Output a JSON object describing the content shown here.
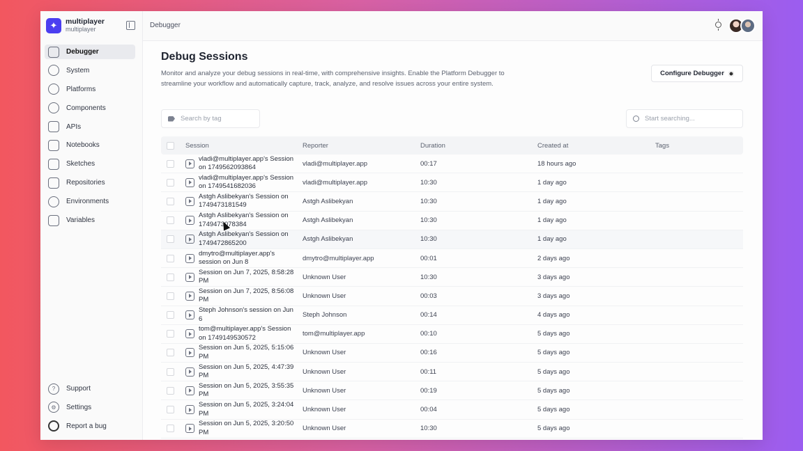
{
  "app": {
    "name": "multiplayer",
    "workspace": "multiplayer"
  },
  "sidebar": {
    "items": [
      {
        "label": "Debugger",
        "icon": "play-icon",
        "active": true
      },
      {
        "label": "System",
        "icon": "chart-icon"
      },
      {
        "label": "Platforms",
        "icon": "cube-icon"
      },
      {
        "label": "Components",
        "icon": "hexagon-icon"
      },
      {
        "label": "APIs",
        "icon": "api-icon"
      },
      {
        "label": "Notebooks",
        "icon": "notebook-icon"
      },
      {
        "label": "Sketches",
        "icon": "pencil-icon"
      },
      {
        "label": "Repositories",
        "icon": "code-icon"
      },
      {
        "label": "Environments",
        "icon": "cloud-icon"
      },
      {
        "label": "Variables",
        "icon": "variable-icon"
      }
    ],
    "bottom": [
      {
        "label": "Support",
        "icon": "help-icon"
      },
      {
        "label": "Settings",
        "icon": "gear-icon"
      },
      {
        "label": "Report a bug",
        "icon": "bug-icon"
      }
    ]
  },
  "topbar": {
    "breadcrumb": "Debugger"
  },
  "page": {
    "title": "Debug Sessions",
    "description": "Monitor and analyze your debug sessions in real-time, with comprehensive insights. Enable the Platform Debugger to streamline your workflow and automatically capture, track, analyze, and resolve issues across your entire system.",
    "configure_label": "Configure Debugger",
    "tag_placeholder": "Search by tag",
    "search_placeholder": "Start searching..."
  },
  "table": {
    "columns": [
      "Session",
      "Reporter",
      "Duration",
      "Created at",
      "Tags"
    ],
    "rows": [
      {
        "session": "vladi@multiplayer.app's Session on 1749562093864",
        "reporter": "vladi@multiplayer.app",
        "duration": "00:17",
        "created": "18 hours ago"
      },
      {
        "session": "vladi@multiplayer.app's Session on 1749541682036",
        "reporter": "vladi@multiplayer.app",
        "duration": "10:30",
        "created": "1 day ago"
      },
      {
        "session": "Astgh Aslibekyan's Session on 1749473181549",
        "reporter": "Astgh Aslibekyan",
        "duration": "10:30",
        "created": "1 day ago"
      },
      {
        "session": "Astgh Aslibekyan's Session on 1749473078384",
        "reporter": "Astgh Aslibekyan",
        "duration": "10:30",
        "created": "1 day ago"
      },
      {
        "session": "Astgh Aslibekyan's Session on 1749472865200",
        "reporter": "Astgh Aslibekyan",
        "duration": "10:30",
        "created": "1 day ago"
      },
      {
        "session": "dmytro@multiplayer.app's session on Jun 8",
        "reporter": "dmytro@multiplayer.app",
        "duration": "00:01",
        "created": "2 days ago"
      },
      {
        "session": "Session on Jun 7, 2025, 8:58:28 PM",
        "reporter": "Unknown User",
        "duration": "10:30",
        "created": "3 days ago"
      },
      {
        "session": "Session on Jun 7, 2025, 8:56:08 PM",
        "reporter": "Unknown User",
        "duration": "00:03",
        "created": "3 days ago"
      },
      {
        "session": "Steph Johnson's session on Jun 6",
        "reporter": "Steph Johnson",
        "duration": "00:14",
        "created": "4 days ago"
      },
      {
        "session": "tom@multiplayer.app's Session on 1749149530572",
        "reporter": "tom@multiplayer.app",
        "duration": "00:10",
        "created": "5 days ago"
      },
      {
        "session": "Session on Jun 5, 2025, 5:15:06 PM",
        "reporter": "Unknown User",
        "duration": "00:16",
        "created": "5 days ago"
      },
      {
        "session": "Session on Jun 5, 2025, 4:47:39 PM",
        "reporter": "Unknown User",
        "duration": "00:11",
        "created": "5 days ago"
      },
      {
        "session": "Session on Jun 5, 2025, 3:55:35 PM",
        "reporter": "Unknown User",
        "duration": "00:19",
        "created": "5 days ago"
      },
      {
        "session": "Session on Jun 5, 2025, 3:24:04 PM",
        "reporter": "Unknown User",
        "duration": "00:04",
        "created": "5 days ago"
      },
      {
        "session": "Session on Jun 5, 2025, 3:20:50 PM",
        "reporter": "Unknown User",
        "duration": "10:30",
        "created": "5 days ago"
      }
    ]
  }
}
